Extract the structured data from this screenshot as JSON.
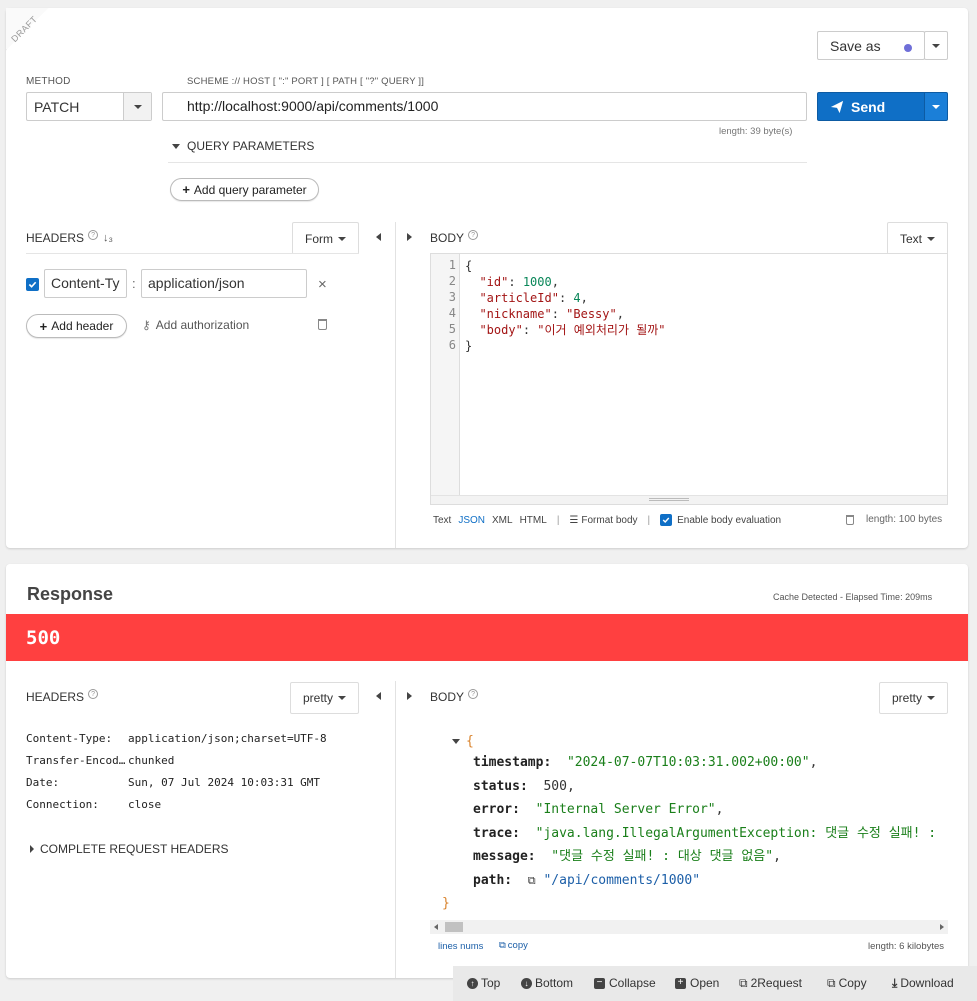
{
  "request": {
    "draft_label": "DRAFT",
    "save_as_label": "Save as",
    "method_label": "METHOD",
    "method_value": "PATCH",
    "scheme_label": "SCHEME :// HOST [ \":\" PORT ] [ PATH [ \"?\" QUERY ]]",
    "url_value": "http://localhost:9000/api/comments/1000",
    "url_length": "length: 39 byte(s)",
    "send_label": "Send",
    "query_params_label": "QUERY PARAMETERS",
    "add_query_param_label": "Add query parameter",
    "headers": {
      "title": "HEADERS",
      "form_label": "Form",
      "items": [
        {
          "name": "Content-Ty",
          "value": "application/json"
        }
      ],
      "add_header_label": "Add header",
      "add_auth_label": "Add authorization"
    },
    "body": {
      "title": "BODY",
      "mode_label": "Text",
      "line_numbers": [
        "1",
        "2",
        "3",
        "4",
        "5",
        "6"
      ],
      "brace_open": "{",
      "brace_close": "}",
      "fields": [
        {
          "key": "\"id\"",
          "value": "1000",
          "type": "number",
          "comma": ","
        },
        {
          "key": "\"articleId\"",
          "value": "4",
          "type": "number",
          "comma": ","
        },
        {
          "key": "\"nickname\"",
          "value": "\"Bessy\"",
          "type": "string",
          "comma": ","
        },
        {
          "key": "\"body\"",
          "value": "\"이거 예외처리가 될까\"",
          "type": "string",
          "comma": ""
        }
      ],
      "formats": [
        "Text",
        "JSON",
        "XML",
        "HTML"
      ],
      "format_body_label": "Format body",
      "enable_eval_label": "Enable body evaluation",
      "length": "length: 100 bytes"
    }
  },
  "response": {
    "title": "Response",
    "meta": "Cache Detected - Elapsed Time: 209ms",
    "status_code": "500",
    "status_color": "#ff4040",
    "headers": {
      "title": "HEADERS",
      "mode_label": "pretty",
      "rows": [
        {
          "name": "Content-Type:",
          "value": "application/json;charset=UTF-8"
        },
        {
          "name": "Transfer-Encod…",
          "value": "chunked"
        },
        {
          "name": "Date:",
          "value": "Sun, 07 Jul 2024 10:03:31 GMT"
        },
        {
          "name": "Connection:",
          "value": "close"
        }
      ],
      "complete_label": "COMPLETE REQUEST HEADERS"
    },
    "body": {
      "title": "BODY",
      "mode_label": "pretty",
      "brace_open": "{",
      "brace_close": "}",
      "fields": [
        {
          "key": "timestamp:",
          "value": "\"2024-07-07T10:03:31.002+00:00\"",
          "type": "string",
          "comma": ","
        },
        {
          "key": "status:",
          "value": "500",
          "type": "number",
          "comma": ","
        },
        {
          "key": "error:",
          "value": "\"Internal Server Error\"",
          "type": "string",
          "comma": ","
        },
        {
          "key": "trace:",
          "value": "\"java.lang.IllegalArgumentException: 댓글 수정 실패! :",
          "type": "string",
          "comma": ""
        },
        {
          "key": "message:",
          "value": "\"댓글 수정 실패! : 대상 댓글 없음\"",
          "type": "string",
          "comma": ","
        },
        {
          "key": "path:",
          "value": "\"/api/comments/1000\"",
          "type": "link",
          "comma": ""
        }
      ],
      "lines_nums_label": "lines nums",
      "copy_label": "copy",
      "length": "length: 6 kilobytes"
    }
  },
  "footer": {
    "top": "Top",
    "bottom": "Bottom",
    "collapse": "Collapse",
    "open": "Open",
    "to_request": "2Request",
    "copy": "Copy",
    "download": "Download"
  },
  "colors": {
    "accent": "#0f6fc6",
    "send_dark": "#0d5ba3",
    "error": "#ff4040",
    "dot": "#6f6fd8"
  }
}
